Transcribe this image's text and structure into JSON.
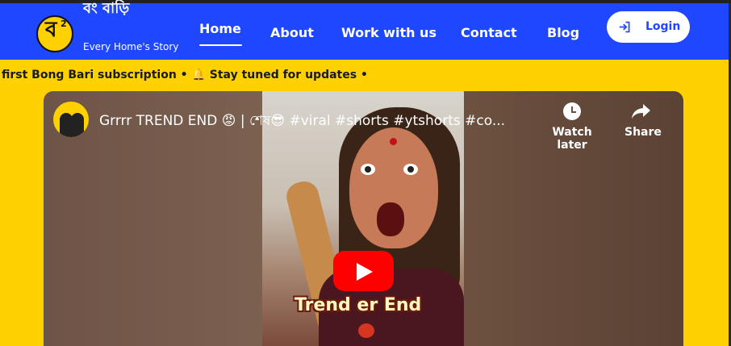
{
  "header": {
    "brand_fragment": "বং বাড়ি",
    "logo_glyph": "ব",
    "logo_superscript": "2",
    "tagline": "Every Home's Story",
    "nav": {
      "home": "Home",
      "about": "About",
      "work": "Work with us",
      "contact": "Contact",
      "blog": "Blog"
    },
    "login_label": "Login"
  },
  "ticker": {
    "text": "first Bong Bari subscription • 🔔 Stay tuned for updates •"
  },
  "video": {
    "title": "Grrrr TREND END 😡 | শেষ😎 #viral #shorts #ytshorts #co...",
    "watch_later_label": "Watch later",
    "share_label": "Share",
    "caption": "Trend er End"
  },
  "colors": {
    "navbar": "#1f47ff",
    "page_background": "#ffd100",
    "youtube_red": "#ff0000"
  },
  "icons": [
    "login-icon",
    "clock-icon",
    "share-arrow-icon",
    "play-icon"
  ]
}
